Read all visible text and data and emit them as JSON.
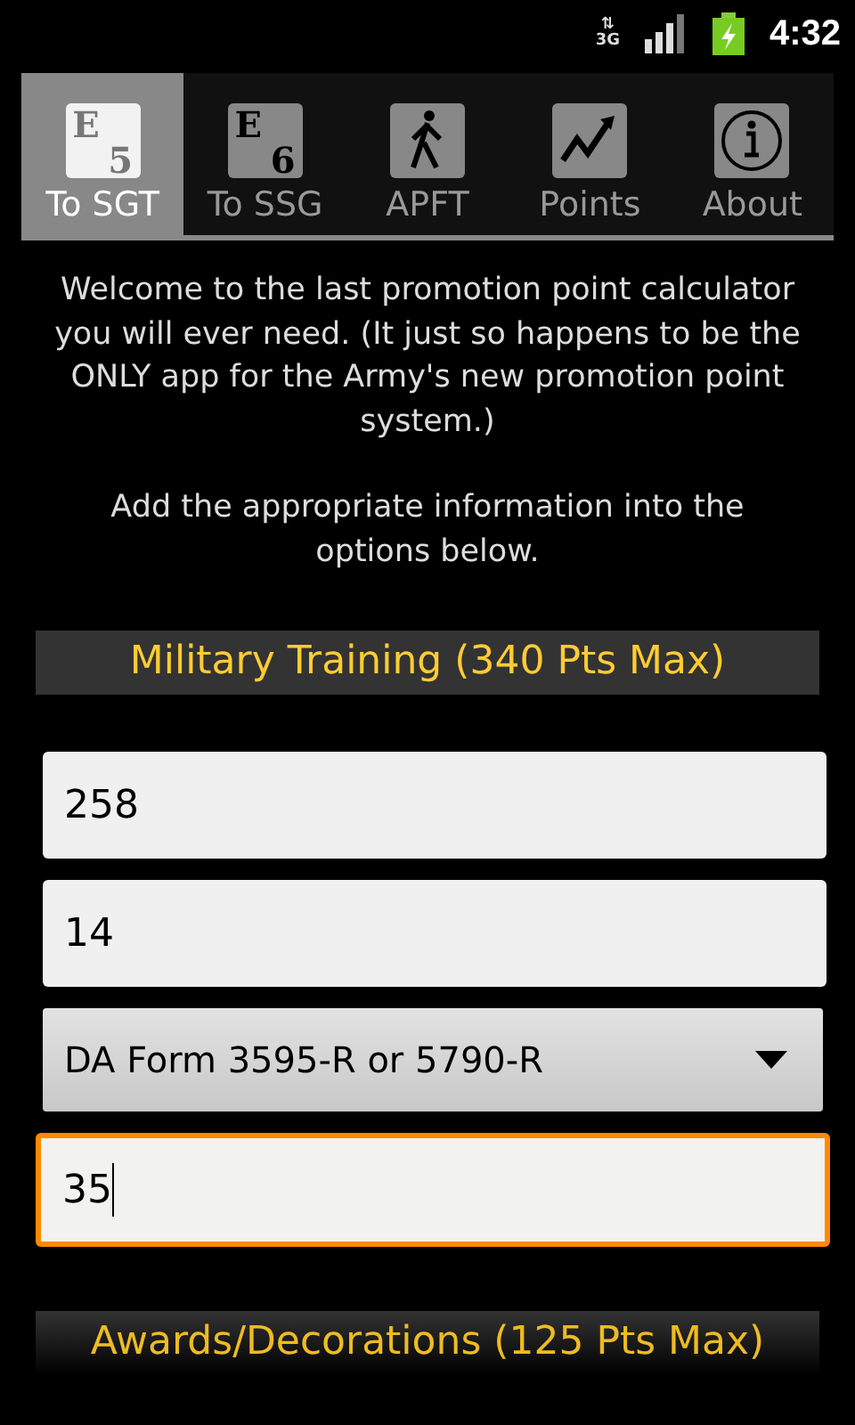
{
  "status_bar": {
    "data_arrows": "⇅",
    "network": "3G",
    "time": "4:32"
  },
  "tabs": [
    {
      "label": "To SGT",
      "selected": true,
      "kind": "grade",
      "icon_letter": "E",
      "icon_number": "5"
    },
    {
      "label": "To SSG",
      "selected": false,
      "kind": "grade",
      "icon_letter": "E",
      "icon_number": "6"
    },
    {
      "label": "APFT",
      "selected": false,
      "kind": "walker"
    },
    {
      "label": "Points",
      "selected": false,
      "kind": "chart"
    },
    {
      "label": "About",
      "selected": false,
      "kind": "info"
    }
  ],
  "intro": [
    "Welcome to the last promotion point calculator you will ever need. (It just so happens to be the ONLY app for the Army's new promotion point system.)",
    "Add the appropriate information into the options below."
  ],
  "sections": [
    {
      "title": "Military Training (340 Pts Max)",
      "fields": [
        {
          "kind": "text",
          "value": "258",
          "focused": false
        },
        {
          "kind": "text",
          "value": "14",
          "focused": false
        },
        {
          "kind": "select",
          "value": "DA Form 3595-R or 5790-R",
          "focused": false
        },
        {
          "kind": "text",
          "value": "35",
          "focused": true
        }
      ]
    },
    {
      "title": "Awards/Decorations (125 Pts Max)"
    }
  ]
}
